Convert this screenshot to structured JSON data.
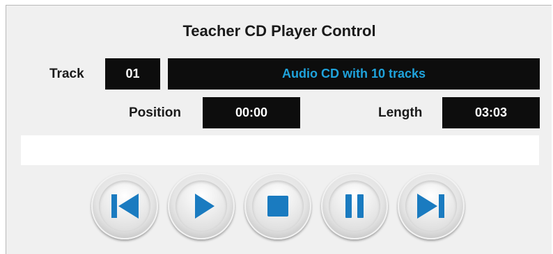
{
  "panel": {
    "title": "Teacher CD Player Control"
  },
  "track": {
    "label": "Track",
    "number": "01",
    "status": "Audio CD with 10 tracks"
  },
  "position": {
    "label": "Position",
    "value": "00:00"
  },
  "length": {
    "label": "Length",
    "value": "03:03"
  },
  "progress": {
    "fraction": 0.0
  },
  "controls": [
    {
      "name": "previous-track",
      "icon": "skip-previous-icon"
    },
    {
      "name": "play",
      "icon": "play-icon"
    },
    {
      "name": "stop",
      "icon": "stop-icon"
    },
    {
      "name": "pause",
      "icon": "pause-icon"
    },
    {
      "name": "next-track",
      "icon": "skip-next-icon"
    }
  ],
  "colors": {
    "lcd_background": "#0d0d0d",
    "lcd_text": "#ffffff",
    "status_text": "#1fa3dc",
    "icon": "#1a7bc0",
    "panel_background": "#f0f0f0"
  }
}
